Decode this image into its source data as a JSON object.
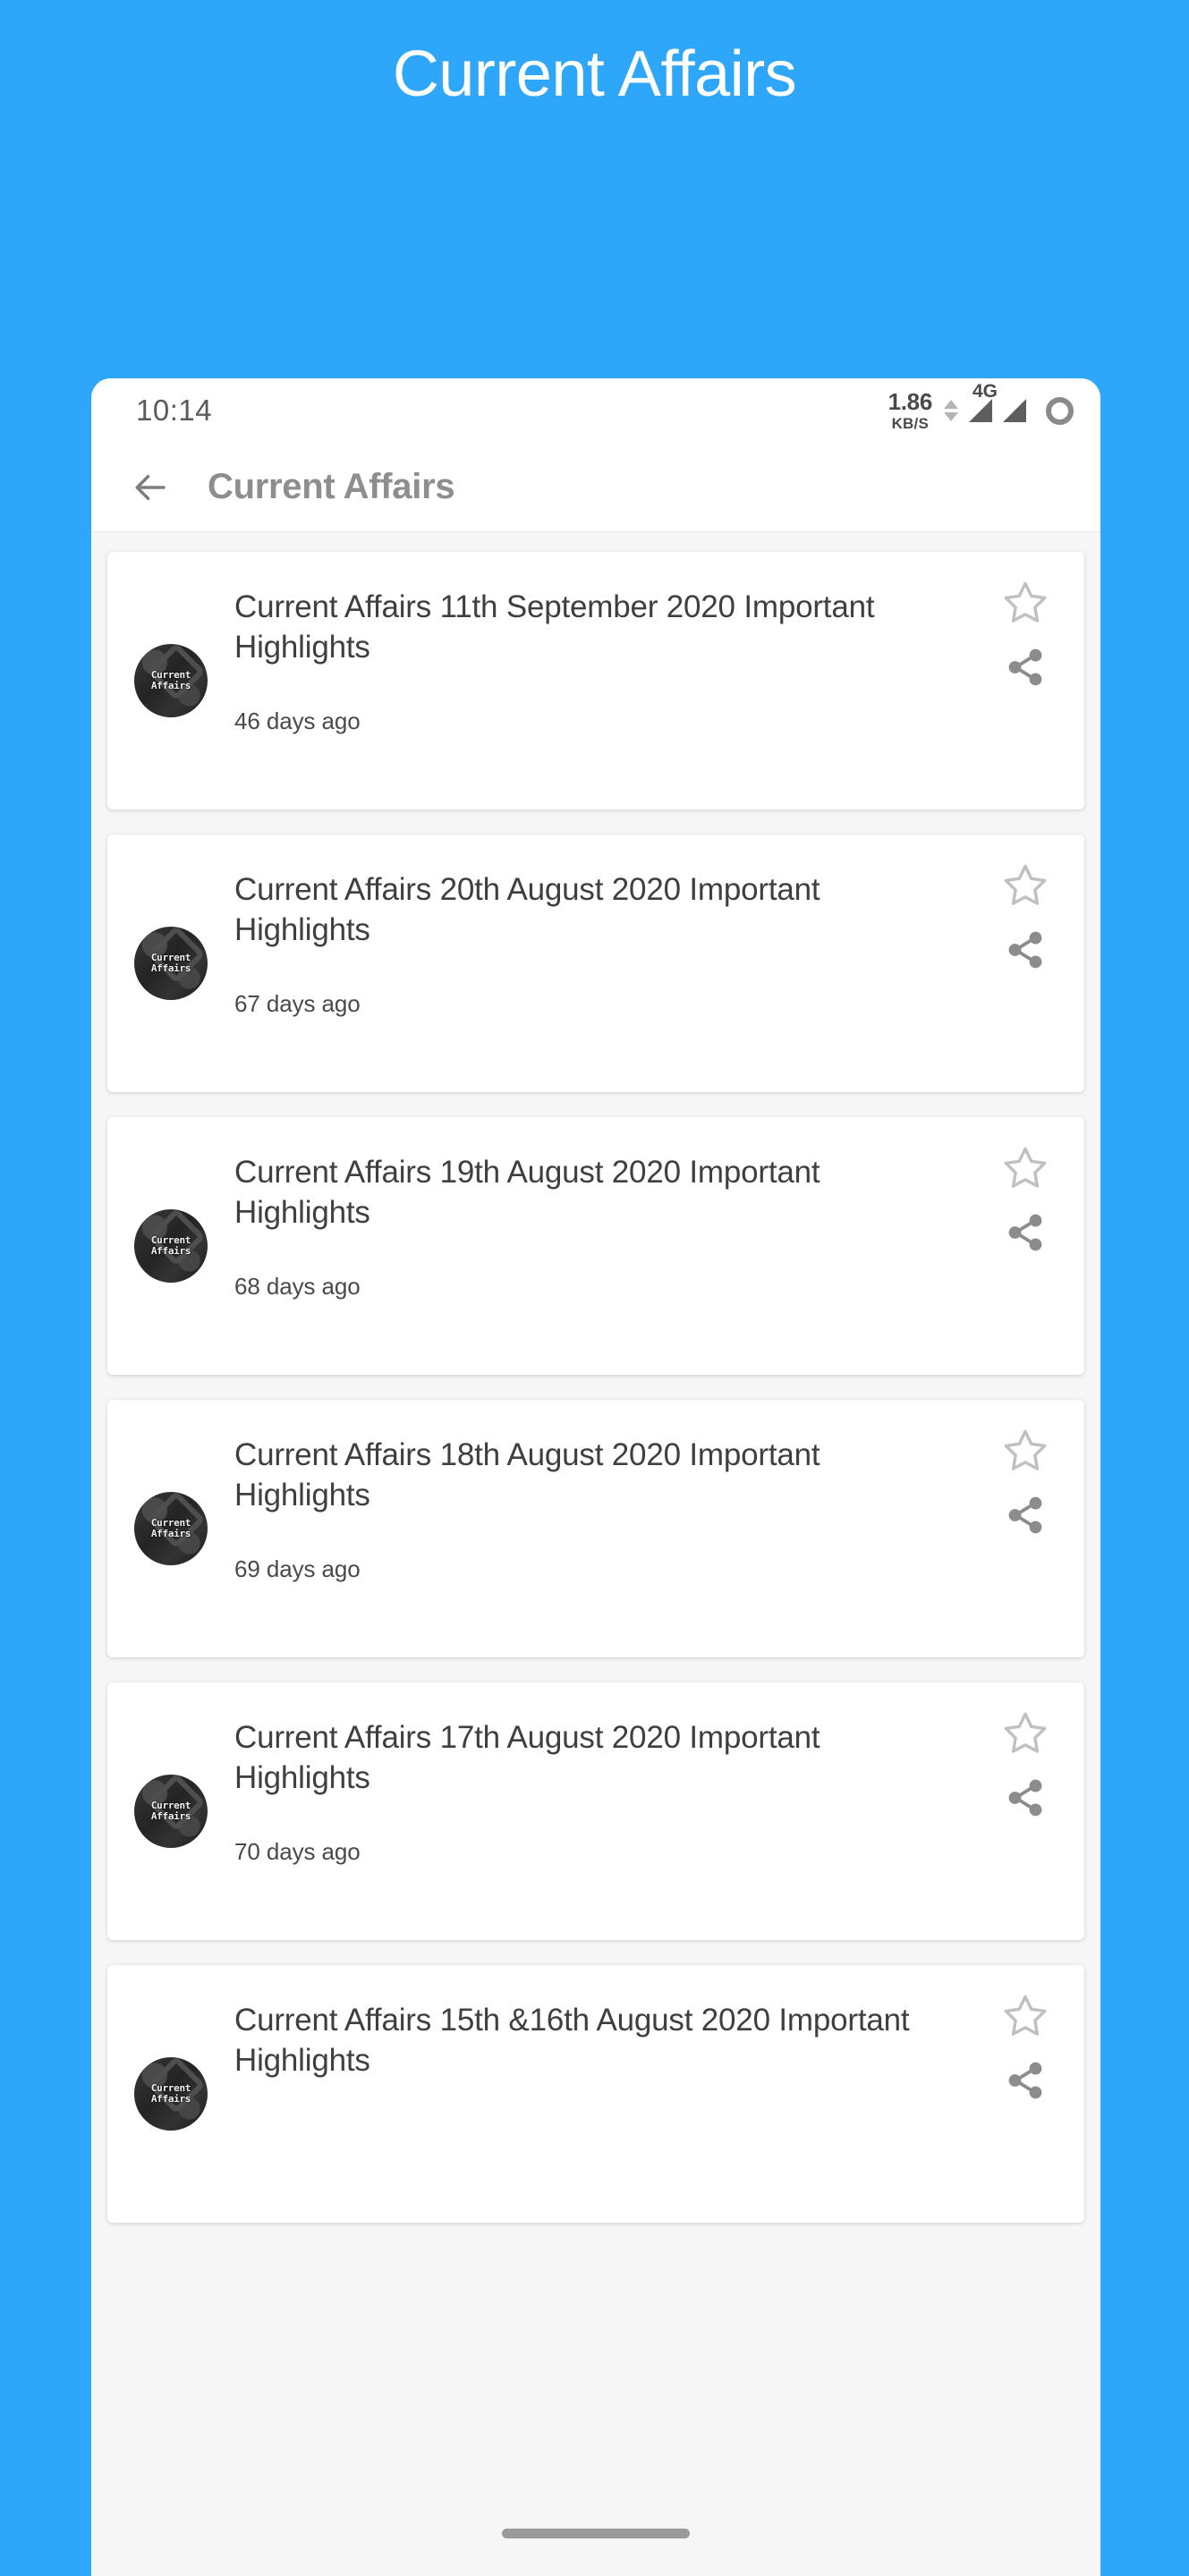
{
  "banner": {
    "title": "Current Affairs",
    "background_color": "#2ea7fb",
    "text_color": "#ffffff"
  },
  "statusbar": {
    "time": "10:14",
    "network_speed_value": "1.86",
    "network_speed_unit": "KB/S",
    "network_type": "4G"
  },
  "appbar": {
    "title": "Current Affairs",
    "back_label": "Back"
  },
  "thumbnail": {
    "line1": "Current",
    "line2": "Affairs"
  },
  "cards": [
    {
      "title": "Current Affairs 11th September 2020 Important Highlights",
      "date": "46 days ago"
    },
    {
      "title": "Current Affairs 20th August 2020 Important Highlights",
      "date": "67 days ago"
    },
    {
      "title": "Current Affairs 19th August 2020 Important Highlights",
      "date": "68 days ago"
    },
    {
      "title": "Current Affairs 18th August 2020 Important Highlights",
      "date": "69 days ago"
    },
    {
      "title": "Current Affairs 17th August 2020 Important Highlights",
      "date": "70 days ago"
    },
    {
      "title": "Current Affairs 15th &16th August 2020 Important Highlights",
      "date": ""
    }
  ]
}
